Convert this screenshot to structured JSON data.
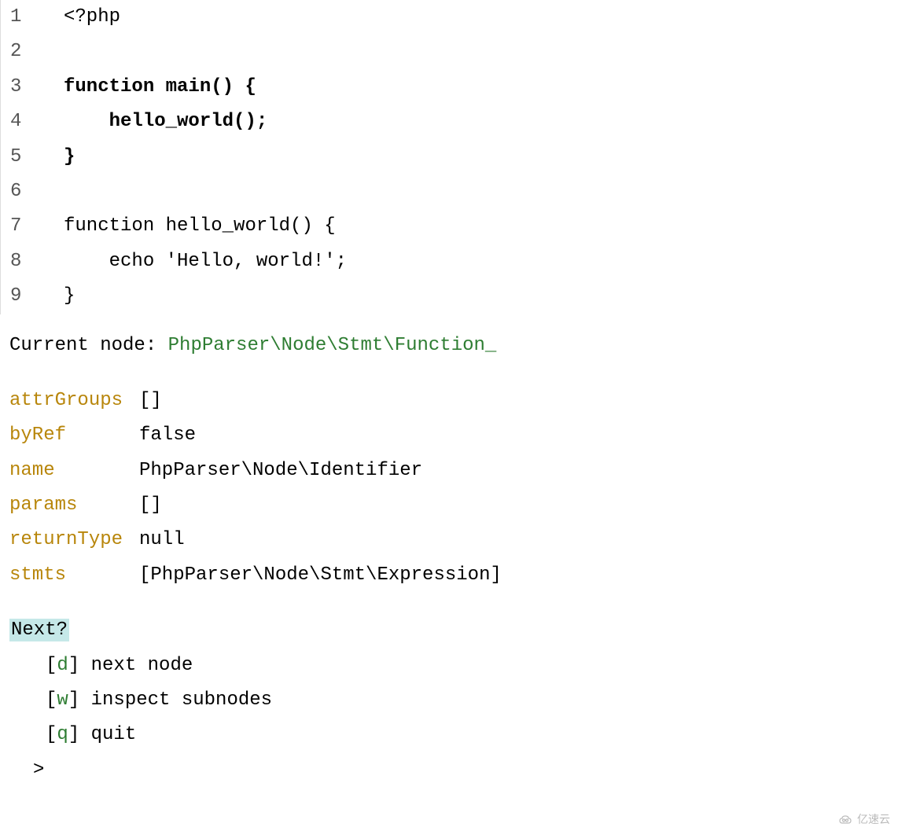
{
  "code": {
    "lines": [
      {
        "num": "1",
        "content": "<?php",
        "bold": false
      },
      {
        "num": "2",
        "content": "",
        "bold": false
      },
      {
        "num": "3",
        "content": "function main() {",
        "bold": true
      },
      {
        "num": "4",
        "content": "    hello_world();",
        "bold": true
      },
      {
        "num": "5",
        "content": "}",
        "bold": true
      },
      {
        "num": "6",
        "content": "",
        "bold": false
      },
      {
        "num": "7",
        "content": "function hello_world() {",
        "bold": false
      },
      {
        "num": "8",
        "content": "    echo 'Hello, world!';",
        "bold": false
      },
      {
        "num": "9",
        "content": "}",
        "bold": false
      }
    ]
  },
  "currentNode": {
    "label": "Current node: ",
    "value": "PhpParser\\Node\\Stmt\\Function_"
  },
  "properties": [
    {
      "key": "attrGroups",
      "value": "[]"
    },
    {
      "key": "byRef",
      "value": "false"
    },
    {
      "key": "name",
      "value": "PhpParser\\Node\\Identifier"
    },
    {
      "key": "params",
      "value": "[]"
    },
    {
      "key": "returnType",
      "value": "null"
    },
    {
      "key": "stmts",
      "value": "[PhpParser\\Node\\Stmt\\Expression]"
    }
  ],
  "menu": {
    "title": "Next?",
    "items": [
      {
        "key": "d",
        "label": "next node"
      },
      {
        "key": "w",
        "label": "inspect subnodes"
      },
      {
        "key": "q",
        "label": "quit"
      }
    ],
    "prompt": ">"
  },
  "watermark": "亿速云"
}
